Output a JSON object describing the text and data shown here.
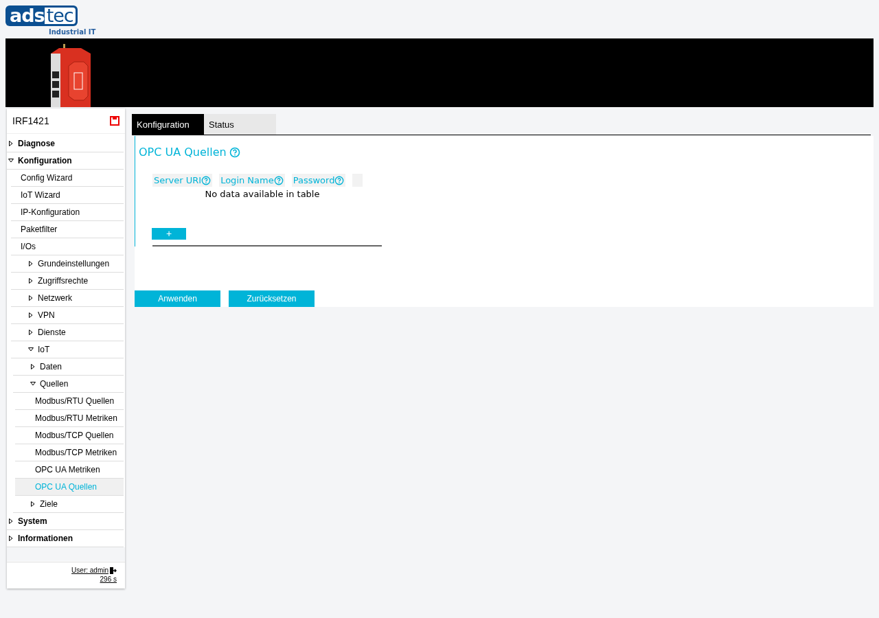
{
  "logo": {
    "part_1": "ads",
    "part_2": "tec",
    "tagline": "Industrial IT"
  },
  "banner": {
    "kind": "picture"
  },
  "sidebar": {
    "device": "IRF1421",
    "tree": [
      {
        "kind": "folder",
        "label": "Diagnose",
        "expanded": false
      },
      {
        "kind": "folder",
        "label": "Konfiguration",
        "expanded": true,
        "children": [
          {
            "kind": "item",
            "label": "Config Wizard",
            "selected": false
          },
          {
            "kind": "item",
            "label": "IoT Wizard",
            "selected": false
          },
          {
            "kind": "item",
            "label": "IP-Konfiguration",
            "selected": false
          },
          {
            "kind": "item",
            "label": "Paketfilter",
            "selected": false
          },
          {
            "kind": "item",
            "label": "I/Os",
            "selected": false
          },
          {
            "kind": "folder",
            "label": "Grundeinstellungen",
            "expanded": false
          },
          {
            "kind": "folder",
            "label": "Zugriffsrechte",
            "expanded": false
          },
          {
            "kind": "folder",
            "label": "Netzwerk",
            "expanded": false
          },
          {
            "kind": "folder",
            "label": "VPN",
            "expanded": false
          },
          {
            "kind": "folder",
            "label": "Dienste",
            "expanded": false
          },
          {
            "kind": "folder",
            "label": "IoT",
            "expanded": true,
            "children": [
              {
                "kind": "folder",
                "label": "Daten",
                "expanded": false
              },
              {
                "kind": "folder",
                "label": "Quellen",
                "expanded": true,
                "children": [
                  {
                    "kind": "item",
                    "label": "Modbus/RTU Quellen",
                    "selected": false
                  },
                  {
                    "kind": "item",
                    "label": "Modbus/RTU Metriken",
                    "selected": false
                  },
                  {
                    "kind": "item",
                    "label": "Modbus/TCP Quellen",
                    "selected": false
                  },
                  {
                    "kind": "item",
                    "label": "Modbus/TCP Metriken",
                    "selected": false
                  },
                  {
                    "kind": "item",
                    "label": "OPC UA Metriken",
                    "selected": false
                  },
                  {
                    "kind": "item",
                    "label": "OPC UA Quellen",
                    "selected": true
                  }
                ]
              },
              {
                "kind": "folder",
                "label": "Ziele",
                "expanded": false
              }
            ]
          }
        ]
      },
      {
        "kind": "folder",
        "label": "System",
        "expanded": false
      },
      {
        "kind": "folder",
        "label": "Informationen",
        "expanded": false
      }
    ],
    "user": "User: admin",
    "timer": "296 s"
  },
  "tabs": [
    {
      "label": "Konfiguration",
      "selected": true
    },
    {
      "label": "Status",
      "selected": false
    }
  ],
  "section": {
    "title": "OPC UA Quellen",
    "table": {
      "columns": [
        "Server URI",
        "Login Name",
        "Password"
      ],
      "empty_message": "No data available in table"
    },
    "add_button": "+"
  },
  "buttons": [
    "Anwenden",
    "Zurücksetzen"
  ]
}
